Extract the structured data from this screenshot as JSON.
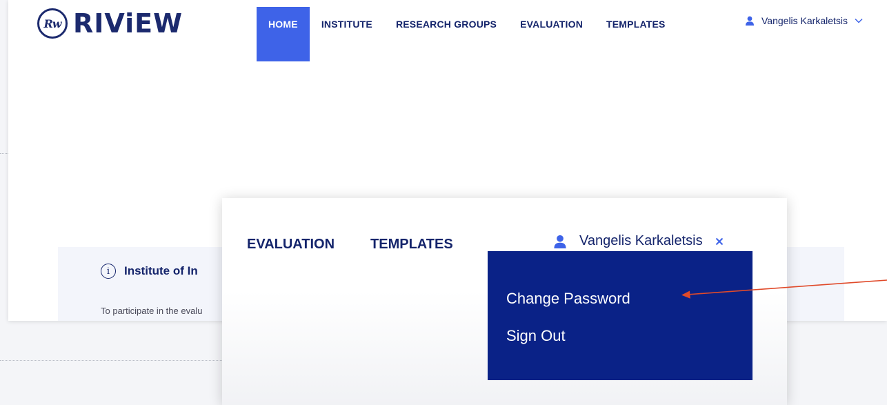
{
  "app": {
    "logo_mark": "Rw",
    "logo_text": "RIViEW"
  },
  "nav": {
    "items": [
      {
        "label": "HOME",
        "active": true
      },
      {
        "label": "INSTITUTE",
        "active": false
      },
      {
        "label": "RESEARCH GROUPS",
        "active": false
      },
      {
        "label": "EVALUATION",
        "active": false
      },
      {
        "label": "TEMPLATES",
        "active": false
      }
    ]
  },
  "user": {
    "name": "Vangelis Karkaletsis",
    "icon": "user-icon",
    "toggle_icon": "chevron-down-icon"
  },
  "info": {
    "icon": "info-icon",
    "title": "Institute of In",
    "text": "To participate in the evalu"
  },
  "zoom": {
    "nav": [
      "EVALUATION",
      "TEMPLATES"
    ],
    "user_name": "Vangelis Karkaletsis",
    "close_icon": "close-icon",
    "menu": {
      "change_password": "Change Password",
      "sign_out": "Sign Out"
    }
  },
  "colors": {
    "primary": "#14246b",
    "active_tab": "#3e63e8",
    "dropdown_bg": "#0a2287",
    "annotation_arrow": "#e04a2a"
  }
}
